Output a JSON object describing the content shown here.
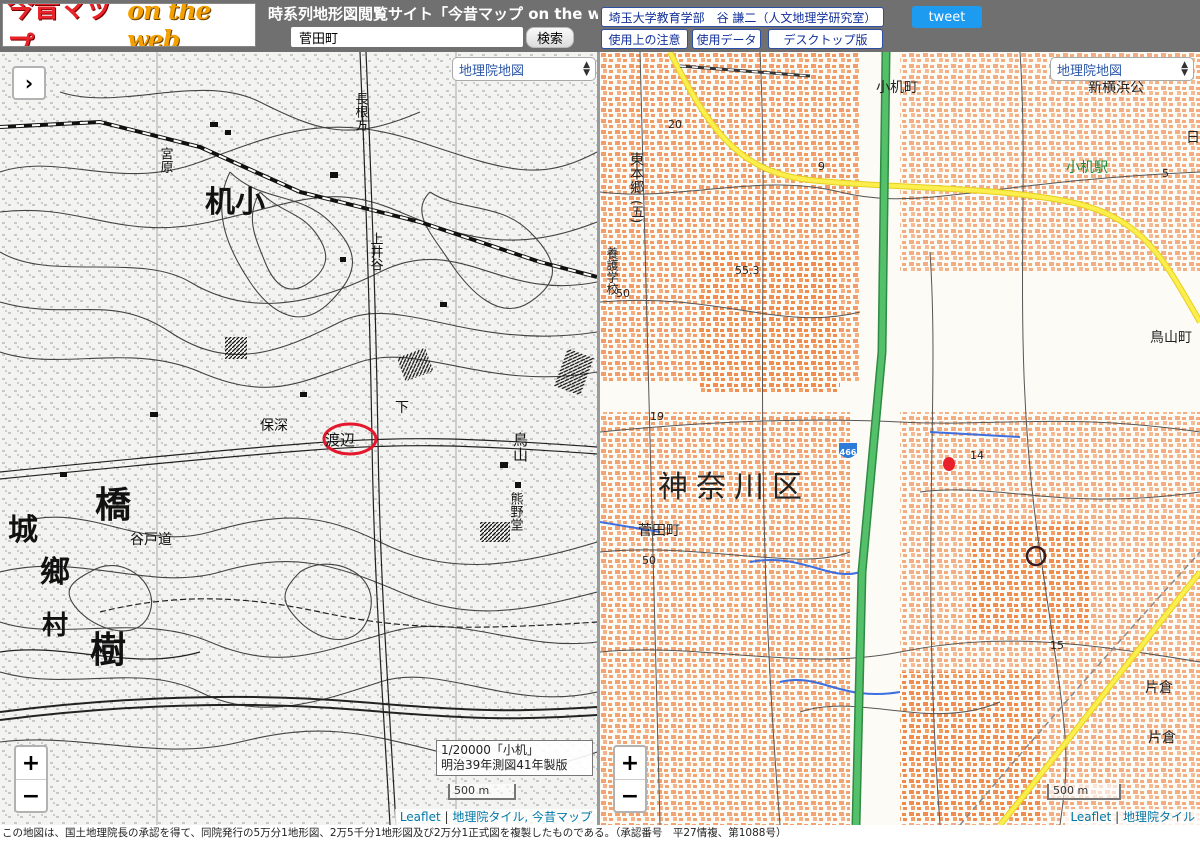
{
  "header": {
    "logo_main": "今昔マップ",
    "logo_sub": "on the web",
    "site_title": "時系列地形図閲覧サイト「今昔マップ on the web」",
    "search_value": "菅田町",
    "search_button": "検索",
    "credit": "埼玉大学教育学部　谷 謙二（人文地理学研究室）",
    "notice": "使用上の注意",
    "data": "使用データ",
    "desktop": "デスクトップ版",
    "tweet": "tweet"
  },
  "left_map": {
    "layer": "地理院地図",
    "toggle": "›",
    "zoom_in": "+",
    "zoom_out": "−",
    "info_line1": "1/20000「小机」",
    "info_line2": "明治39年測図41年製版",
    "scale": "500 m",
    "attr_leaflet": "Leaflet",
    "attr_tile": "地理院タイル, 今昔マップ",
    "labels": {
      "kozukue": "机小",
      "hodo": "橋",
      "jo": "城",
      "go": "鄉",
      "mura": "村",
      "ju": "樹",
      "watari": "渡辺",
      "michi": "谷戸道",
      "hosei": "保深",
      "nagasaki": "長根方",
      "shimo": "下",
      "miyaue": "宮原",
      "toriyama": "鳥山",
      "kumano": "熊野堂",
      "kanai": "上井谷"
    }
  },
  "right_map": {
    "layer": "地理院地図",
    "zoom_in": "+",
    "zoom_out": "−",
    "scale": "500 m",
    "attr_leaflet": "Leaflet",
    "attr_tile": "地理院タイル",
    "labels": {
      "ward": "神奈川区",
      "suda": "菅田町",
      "kozukue_town": "小机町",
      "kozukue_station": "小机駅",
      "shin_yokohama": "新横浜公",
      "higashi_hongo": "東本郷",
      "go": "(五)",
      "school": "養護学校",
      "toriyama": "鳥山町",
      "katakura1": "片倉",
      "katakura2": "片倉",
      "route": "466",
      "h553": "55.3",
      "e14": "14",
      "e15": "15",
      "e19": "19",
      "e20": "20",
      "e50": "50",
      "e50b": "50",
      "e5": "5",
      "e9": "9",
      "hi": "日"
    }
  },
  "footer": {
    "text": "この地図は、国土地理院長の承認を得て、同院発行の5万分1地形図、2万5千分1地形図及び2万分1正式図を複製したものである。（承認番号　平27情複、第1088号）"
  },
  "colors": {
    "header_bg": "#707070",
    "accent_link": "#12309a",
    "tweet": "#1d9bf0",
    "highway": "#3aa654",
    "main_road": "#f2e12b",
    "buildings": "#f08c50"
  }
}
